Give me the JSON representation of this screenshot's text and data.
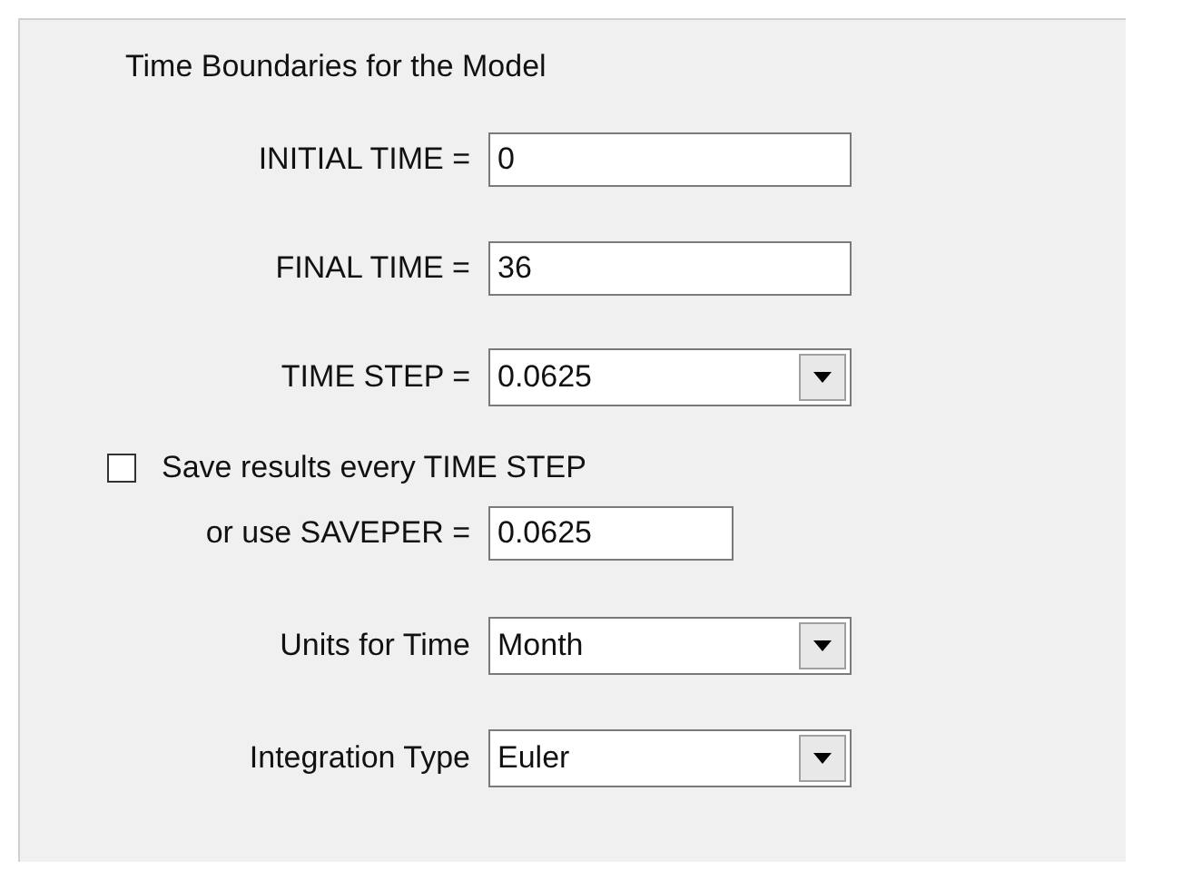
{
  "title": "Time Boundaries for the Model",
  "rows": [
    {
      "kind": "text",
      "label": "INITIAL TIME =",
      "value": "0"
    },
    {
      "kind": "text",
      "label": "FINAL TIME =",
      "value": "36"
    },
    {
      "kind": "combo",
      "label": "TIME STEP =",
      "value": "0.0625"
    },
    {
      "kind": "checkbox",
      "label": "Save results every TIME STEP",
      "checked": false
    },
    {
      "kind": "short-text",
      "label": "or use SAVEPER =",
      "value": "0.0625"
    },
    {
      "kind": "combo",
      "label": "Units for Time",
      "value": "Month"
    },
    {
      "kind": "combo",
      "label": "Integration Type",
      "value": "Euler"
    }
  ]
}
